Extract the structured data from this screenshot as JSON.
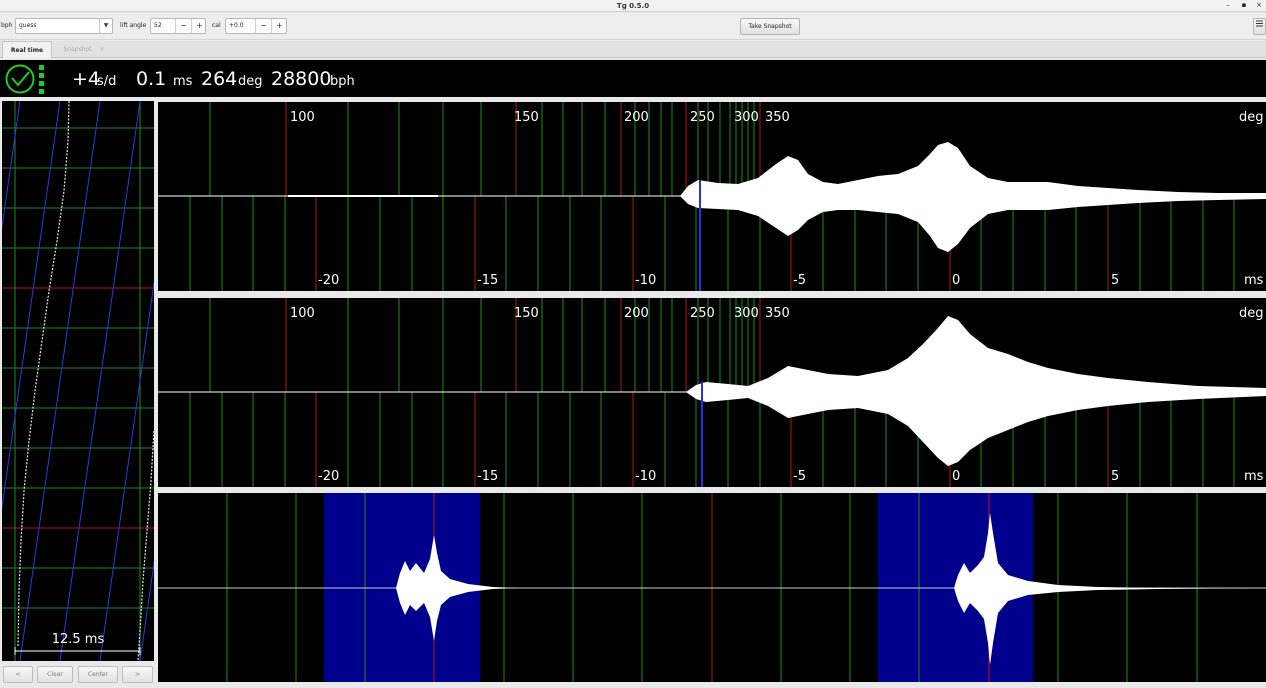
{
  "window": {
    "title": "Tg 0.5.0",
    "controls": [
      "–",
      "▪",
      "×"
    ]
  },
  "toolbar": {
    "bph_label": "bph",
    "bph_value": "guess",
    "lift_angle_label": "lift angle",
    "lift_angle_value": "52",
    "cal_label": "cal",
    "cal_value": "+0.0",
    "minus": "−",
    "plus": "+",
    "snapshot_button": "Take Snapshot",
    "menu_icon": "hamburger-menu-icon"
  },
  "tabs": [
    {
      "label": "Real time",
      "active": true
    },
    {
      "label": "Snapshot",
      "active": false,
      "close": "×"
    }
  ],
  "status": {
    "icon": "clock-check-icon",
    "rate_value": "+4",
    "rate_unit": "s/d",
    "beat_error_value": "0.1",
    "beat_error_unit": "ms",
    "amplitude_value": "264",
    "amplitude_unit": "deg",
    "bph_value": "28800",
    "bph_unit": "bph",
    "indicator_color": "#22cc22"
  },
  "paperstrip": {
    "scale_label": "12.5 ms",
    "buttons": [
      "<",
      "Clear",
      "Center",
      ">"
    ]
  },
  "tic_panel": {
    "deg_ticks": [
      "100",
      "150",
      "200",
      "250",
      "300",
      "350"
    ],
    "deg_unit": "deg",
    "ms_ticks": [
      "-20",
      "-15",
      "-10",
      "-5",
      "0",
      "5"
    ],
    "ms_unit": "ms"
  },
  "toc_panel": {
    "deg_ticks": [
      "100",
      "150",
      "200",
      "250",
      "300",
      "350"
    ],
    "deg_unit": "deg",
    "ms_ticks": [
      "-20",
      "-15",
      "-10",
      "-5",
      "0",
      "5"
    ],
    "ms_unit": "ms"
  },
  "colors": {
    "grid_green": "#1e8a1e",
    "grid_red": "#b01818",
    "amplitude_marker_blue": "#2233ee",
    "period_highlight_blue": "#00008c",
    "waveform": "#ffffff",
    "background": "#000000"
  }
}
